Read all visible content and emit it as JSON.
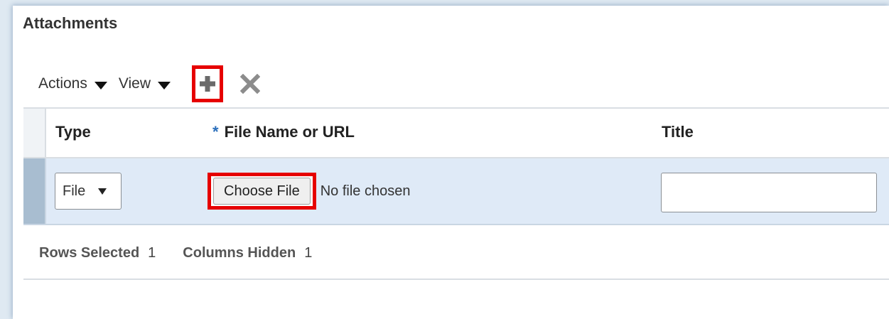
{
  "panel": {
    "title": "Attachments"
  },
  "toolbar": {
    "actions_label": "Actions",
    "view_label": "View",
    "add_icon": "plus-icon",
    "delete_icon": "x-icon"
  },
  "table": {
    "columns": [
      {
        "label": "Type",
        "required": false
      },
      {
        "label": "File Name or URL",
        "required": true,
        "required_marker": "*"
      },
      {
        "label": "Title",
        "required": false
      }
    ],
    "rows": [
      {
        "type_value": "File",
        "choose_file_label": "Choose File",
        "file_status": "No file chosen",
        "title_value": ""
      }
    ]
  },
  "footer": {
    "rows_selected_label": "Rows Selected",
    "rows_selected_value": "1",
    "columns_hidden_label": "Columns Hidden",
    "columns_hidden_value": "1"
  },
  "colors": {
    "highlight_box": "#e60000",
    "required_marker": "#2a6ebb",
    "selected_row_bg": "#dfeaf7",
    "row_indicator": "#a8bdd0"
  }
}
